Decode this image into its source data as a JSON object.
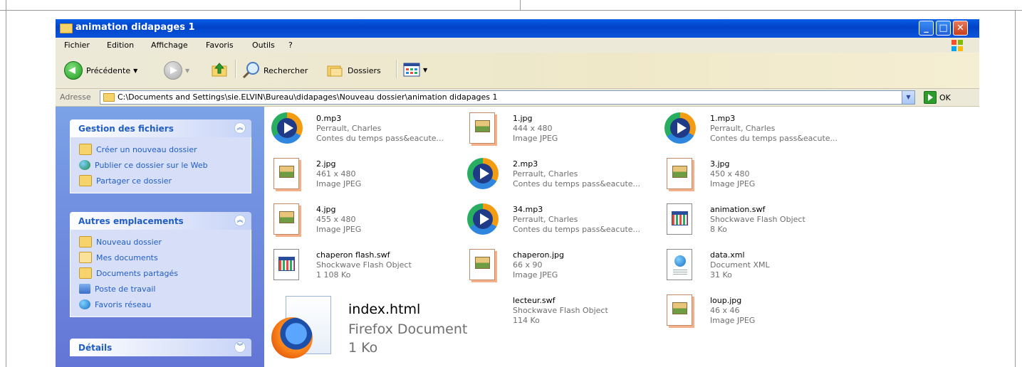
{
  "window": {
    "title": "animation didapages 1",
    "buttons": {
      "minimize": "_",
      "maximize": "□",
      "close": "✕"
    }
  },
  "menu": [
    "Fichier",
    "Edition",
    "Affichage",
    "Favoris",
    "Outils",
    "?"
  ],
  "toolbar": {
    "back_label": "Précédente",
    "search_label": "Rechercher",
    "folders_label": "Dossiers"
  },
  "address": {
    "label": "Adresse",
    "value": "C:\\Documents and Settings\\sie.ELVIN\\Bureau\\didapages\\Nouveau dossier\\animation didapages 1",
    "go_label": "OK"
  },
  "taskpane": {
    "file_tasks": {
      "title": "Gestion des fichiers",
      "items": [
        "Créer un nouveau dossier",
        "Publier ce dossier sur le Web",
        "Partager ce dossier"
      ]
    },
    "other_places": {
      "title": "Autres emplacements",
      "items": [
        "Nouveau dossier",
        "Mes documents",
        "Documents partagés",
        "Poste de travail",
        "Favoris réseau"
      ]
    },
    "details": {
      "title": "Détails"
    }
  },
  "files": [
    {
      "name": "0.mp3",
      "line1": "Perrault, Charles",
      "line2": "Contes du temps pass&eacute...",
      "icon": "mp3-icon"
    },
    {
      "name": "1.jpg",
      "line1": "444 x 480",
      "line2": "Image JPEG",
      "icon": "jpg-icon"
    },
    {
      "name": "1.mp3",
      "line1": "Perrault, Charles",
      "line2": "Contes du temps pass&eacute...",
      "icon": "mp3-icon"
    },
    {
      "name": "2.jpg",
      "line1": "461 x 480",
      "line2": "Image JPEG",
      "icon": "jpg-icon"
    },
    {
      "name": "2.mp3",
      "line1": "Perrault, Charles",
      "line2": "Contes du temps pass&eacute...",
      "icon": "mp3-icon"
    },
    {
      "name": "3.jpg",
      "line1": "450 x 480",
      "line2": "Image JPEG",
      "icon": "jpg-icon"
    },
    {
      "name": "4.jpg",
      "line1": "455 x 480",
      "line2": "Image JPEG",
      "icon": "jpg-icon"
    },
    {
      "name": "34.mp3",
      "line1": "Perrault, Charles",
      "line2": "Contes du temps pass&eacute...",
      "icon": "mp3-icon"
    },
    {
      "name": "animation.swf",
      "line1": "Shockwave Flash Object",
      "line2": "8 Ko",
      "icon": "swf-icon"
    },
    {
      "name": "chaperon flash.swf",
      "line1": "Shockwave Flash Object",
      "line2": "1 108 Ko",
      "icon": "swf-icon"
    },
    {
      "name": "chaperon.jpg",
      "line1": "66 x 90",
      "line2": "Image JPEG",
      "icon": "jpg-icon"
    },
    {
      "name": "data.xml",
      "line1": "Document XML",
      "line2": "31 Ko",
      "icon": "xml-icon"
    },
    {
      "name": "index.html",
      "line1": "Firefox Document",
      "line2": "1 Ko",
      "icon": "firefox-icon"
    },
    {
      "name": "lecteur.swf",
      "line1": "Shockwave Flash Object",
      "line2": "114 Ko",
      "icon": "none"
    },
    {
      "name": "loup.jpg",
      "line1": "46 x 46",
      "line2": "Image JPEG",
      "icon": "jpg-icon"
    }
  ],
  "colors": {
    "titlebar": "#0a54dc",
    "taskpane": "#6375d6",
    "link": "#215dc6"
  }
}
